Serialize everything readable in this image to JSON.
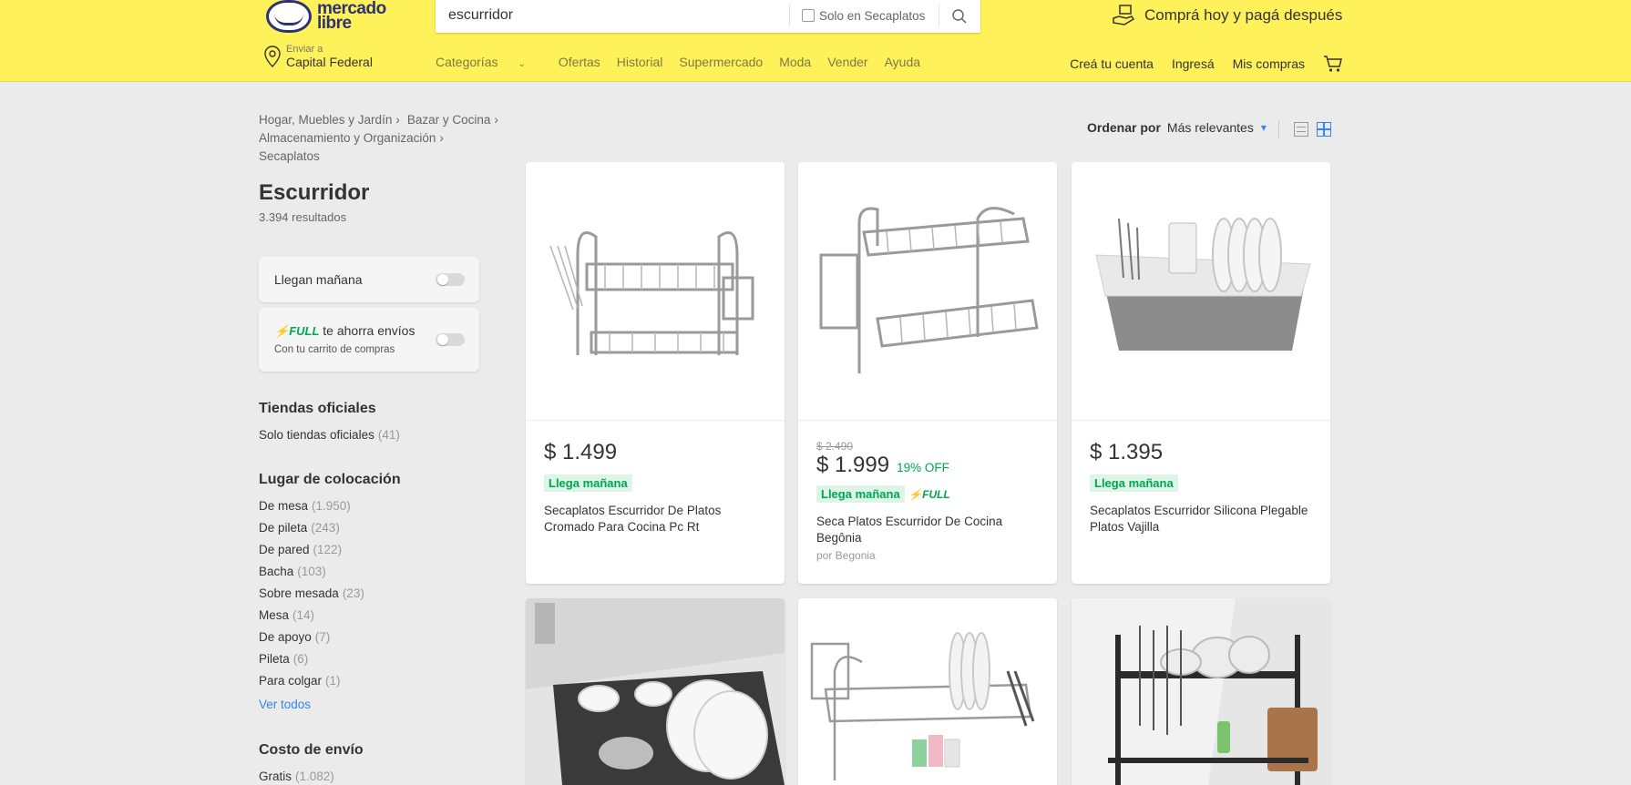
{
  "header": {
    "logo_text": "mercado libre",
    "search": {
      "value": "escurridor",
      "scope_label": "Solo en Secaplatos"
    },
    "promo": "Comprá hoy y pagá después",
    "location": {
      "small": "Enviar a",
      "big": "Capital Federal"
    },
    "nav": [
      "Categorías",
      "Ofertas",
      "Historial",
      "Supermercado",
      "Moda",
      "Vender",
      "Ayuda"
    ],
    "user_nav": [
      "Creá tu cuenta",
      "Ingresá",
      "Mis compras"
    ]
  },
  "breadcrumb": [
    "Hogar, Muebles y Jardín",
    "Bazar y Cocina",
    "Almacenamiento y Organización",
    "Secaplatos"
  ],
  "page": {
    "title": "Escurridor",
    "results": "3.394 resultados"
  },
  "filters": {
    "llegan": "Llegan mañana",
    "full_word": "FULL",
    "full_text": "te ahorra envíos",
    "full_sub": "Con tu carrito de compras",
    "tiendas_title": "Tiendas oficiales",
    "tiendas_item": "Solo tiendas oficiales",
    "tiendas_count": "(41)",
    "lugar_title": "Lugar de colocación",
    "lugar_items": [
      {
        "label": "De mesa",
        "count": "(1.950)"
      },
      {
        "label": "De pileta",
        "count": "(243)"
      },
      {
        "label": "De pared",
        "count": "(122)"
      },
      {
        "label": "Bacha",
        "count": "(103)"
      },
      {
        "label": "Sobre mesada",
        "count": "(23)"
      },
      {
        "label": "Mesa",
        "count": "(14)"
      },
      {
        "label": "De apoyo",
        "count": "(7)"
      },
      {
        "label": "Pileta",
        "count": "(6)"
      },
      {
        "label": "Para colgar",
        "count": "(1)"
      }
    ],
    "ver_todos": "Ver todos",
    "envio_title": "Costo de envío",
    "envio_item": "Gratis",
    "envio_count": "(1.082)"
  },
  "sort": {
    "label": "Ordenar por",
    "value": "Más relevantes"
  },
  "products": [
    {
      "price": "$ 1.499",
      "badge": "Llega mañana",
      "title": "Secaplatos Escurridor De Platos Cromado Para Cocina Pc Rt"
    },
    {
      "old_price": "$ 2.490",
      "price": "$ 1.999",
      "discount": "19% OFF",
      "badge": "Llega mañana",
      "full": "FULL",
      "title": "Seca Platos Escurridor De Cocina Begônia",
      "seller": "por Begonia"
    },
    {
      "price": "$ 1.395",
      "badge": "Llega mañana",
      "title": "Secaplatos Escurridor Silicona Plegable Platos Vajilla"
    }
  ]
}
